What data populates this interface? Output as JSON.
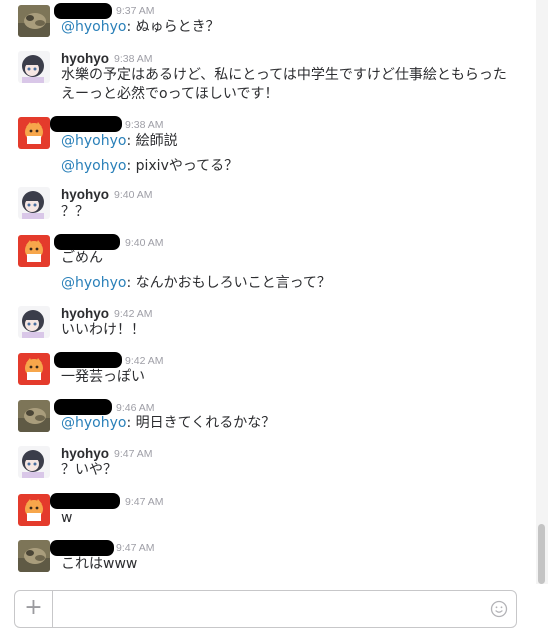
{
  "messages": [
    {
      "avatar": "cat-photo-avatar",
      "author": "",
      "time": "9:37 AM",
      "lines": [
        {
          "mention": "@hyohyo",
          "text": ": ぬゅらとき？"
        }
      ]
    },
    {
      "avatar": "anime-girl-avatar",
      "author": "hyohyo",
      "time": "9:38 AM",
      "lines": [
        {
          "mention": "",
          "text": "水樂の予定はあるけど、私にとっては中学生ですけど仕事絵ともらったえーっと必然でoってほしいです！"
        }
      ]
    },
    {
      "avatar": "orange-character-avatar",
      "author": "",
      "time": "9:38 AM",
      "lines": [
        {
          "mention": "@hyohyo",
          "text": ": 絵師説"
        },
        {
          "mention": "@hyohyo",
          "text": ": pixivやってる？"
        }
      ]
    },
    {
      "avatar": "anime-girl-avatar",
      "author": "hyohyo",
      "time": "9:40 AM",
      "lines": [
        {
          "mention": "",
          "text": "？？"
        }
      ]
    },
    {
      "avatar": "orange-character-avatar",
      "author": "",
      "time": "9:40 AM",
      "lines": [
        {
          "mention": "",
          "text": "ごめん"
        },
        {
          "mention": "@hyohyo",
          "text": ": なんかおもしろいこと言って？"
        }
      ]
    },
    {
      "avatar": "anime-girl-avatar",
      "author": "hyohyo",
      "time": "9:42 AM",
      "lines": [
        {
          "mention": "",
          "text": "いいわけ！！"
        }
      ]
    },
    {
      "avatar": "orange-character-avatar",
      "author": "",
      "time": "9:42 AM",
      "lines": [
        {
          "mention": "",
          "text": "一発芸っぽい"
        }
      ]
    },
    {
      "avatar": "cat-photo-avatar",
      "author": "",
      "time": "9:46 AM",
      "lines": [
        {
          "mention": "@hyohyo",
          "text": ": 明日きてくれるかな？"
        }
      ]
    },
    {
      "avatar": "anime-girl-avatar",
      "author": "hyohyo",
      "time": "9:47 AM",
      "lines": [
        {
          "mention": "",
          "text": "？いや？"
        }
      ]
    },
    {
      "avatar": "orange-character-avatar",
      "author": "",
      "time": "9:47 AM",
      "lines": [
        {
          "mention": "",
          "text": "w"
        }
      ]
    },
    {
      "avatar": "cat-photo-avatar",
      "author": "",
      "time": "9:47 AM",
      "lines": [
        {
          "mention": "",
          "text": "これはwww"
        }
      ]
    }
  ],
  "composer": {
    "attach_label": "+",
    "placeholder": "",
    "emoji_icon": "smiley-icon"
  },
  "colors": {
    "mention": "#2a80b9",
    "timestamp": "#9e9ea6",
    "redaction": "#000000"
  }
}
